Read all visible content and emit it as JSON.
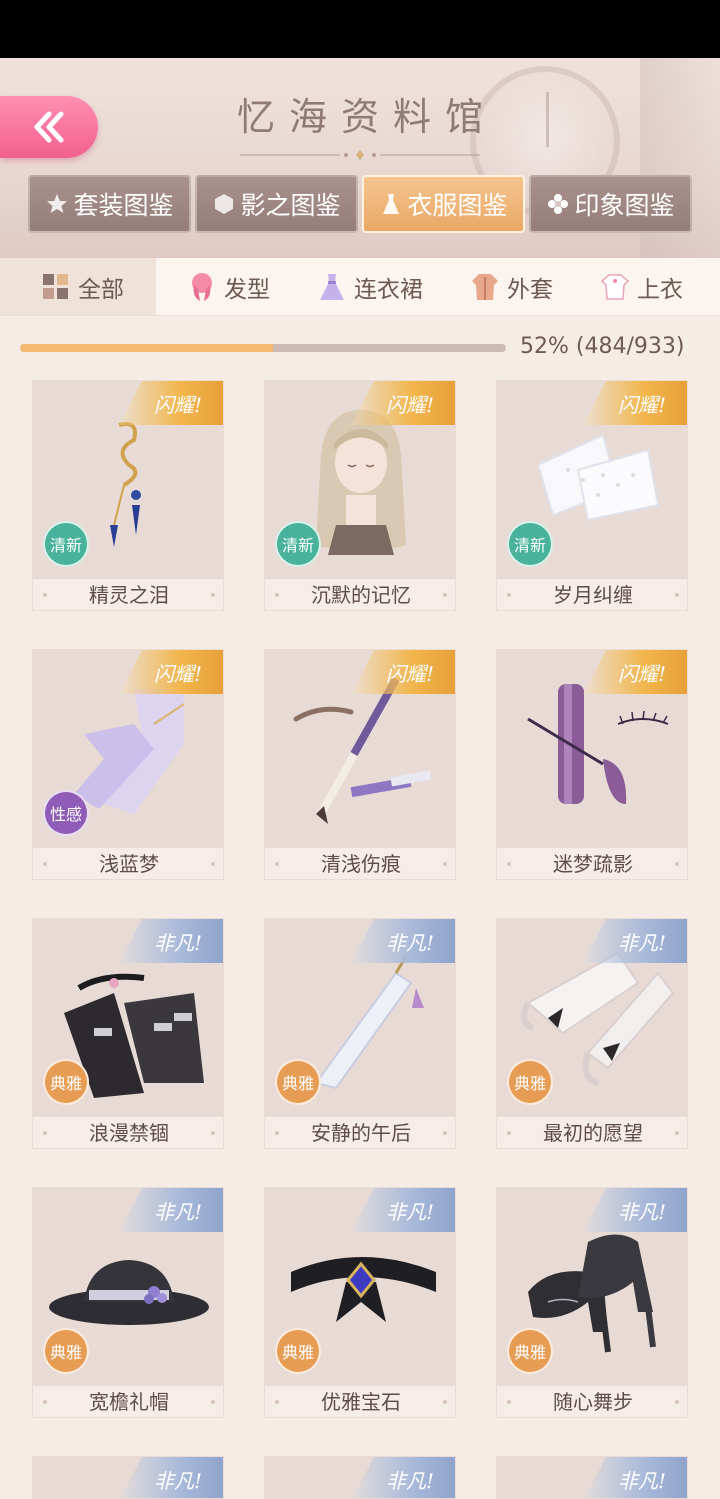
{
  "header": {
    "title": "忆海资料馆",
    "main_tabs": [
      {
        "label": "套装图鉴",
        "icon": "star-icon",
        "active": false
      },
      {
        "label": "影之图鉴",
        "icon": "hexagon-icon",
        "active": false
      },
      {
        "label": "衣服图鉴",
        "icon": "dress-icon",
        "active": true
      },
      {
        "label": "印象图鉴",
        "icon": "flower-icon",
        "active": false
      }
    ]
  },
  "categories": [
    {
      "label": "全部",
      "icon": "grid-icon",
      "active": true
    },
    {
      "label": "发型",
      "icon": "hair-icon",
      "active": false
    },
    {
      "label": "连衣裙",
      "icon": "dress-icon",
      "active": false
    },
    {
      "label": "外套",
      "icon": "coat-icon",
      "active": false
    },
    {
      "label": "上衣",
      "icon": "shirt-icon",
      "active": false
    }
  ],
  "progress": {
    "percent": 52,
    "text": "52% (484/933)"
  },
  "colors": {
    "accent": "#f4b86e",
    "back_button": "#f2608e",
    "gold_ribbon": "#f2b54a",
    "blue_ribbon": "#a8b9d9",
    "fresh": "#48b39a",
    "sexy": "#8f5db8",
    "elegant": "#e79c54"
  },
  "items": [
    {
      "name": "精灵之泪",
      "rarity": "闪耀!",
      "tier": "gold",
      "style": "清新",
      "style_kind": "fresh",
      "art": "earring-icon"
    },
    {
      "name": "沉默的记忆",
      "rarity": "闪耀!",
      "tier": "gold",
      "style": "清新",
      "style_kind": "fresh",
      "art": "hairstyle-icon"
    },
    {
      "name": "岁月纠缠",
      "rarity": "闪耀!",
      "tier": "gold",
      "style": "清新",
      "style_kind": "fresh",
      "art": "lace-gloves-icon"
    },
    {
      "name": "浅蓝梦",
      "rarity": "闪耀!",
      "tier": "gold",
      "style": "性感",
      "style_kind": "sexy",
      "art": "stockings-icon"
    },
    {
      "name": "清浅伤痕",
      "rarity": "闪耀!",
      "tier": "gold",
      "style": "",
      "style_kind": "",
      "art": "eyebrow-pencil-icon"
    },
    {
      "name": "迷梦疏影",
      "rarity": "闪耀!",
      "tier": "gold",
      "style": "",
      "style_kind": "",
      "art": "mascara-icon"
    },
    {
      "name": "浪漫禁锢",
      "rarity": "非凡!",
      "tier": "blue",
      "style": "典雅",
      "style_kind": "elegant",
      "art": "garter-icon"
    },
    {
      "name": "安静的午后",
      "rarity": "非凡!",
      "tier": "blue",
      "style": "典雅",
      "style_kind": "elegant",
      "art": "umbrella-icon"
    },
    {
      "name": "最初的愿望",
      "rarity": "非凡!",
      "tier": "blue",
      "style": "典雅",
      "style_kind": "elegant",
      "art": "gloves-icon"
    },
    {
      "name": "宽檐礼帽",
      "rarity": "非凡!",
      "tier": "blue",
      "style": "典雅",
      "style_kind": "elegant",
      "art": "hat-icon"
    },
    {
      "name": "优雅宝石",
      "rarity": "非凡!",
      "tier": "blue",
      "style": "典雅",
      "style_kind": "elegant",
      "art": "choker-icon"
    },
    {
      "name": "随心舞步",
      "rarity": "非凡!",
      "tier": "blue",
      "style": "典雅",
      "style_kind": "elegant",
      "art": "heels-icon"
    }
  ],
  "partial_items": [
    {
      "rarity": "非凡!",
      "tier": "blue"
    },
    {
      "rarity": "非凡!",
      "tier": "blue"
    },
    {
      "rarity": "非凡!",
      "tier": "blue"
    }
  ]
}
